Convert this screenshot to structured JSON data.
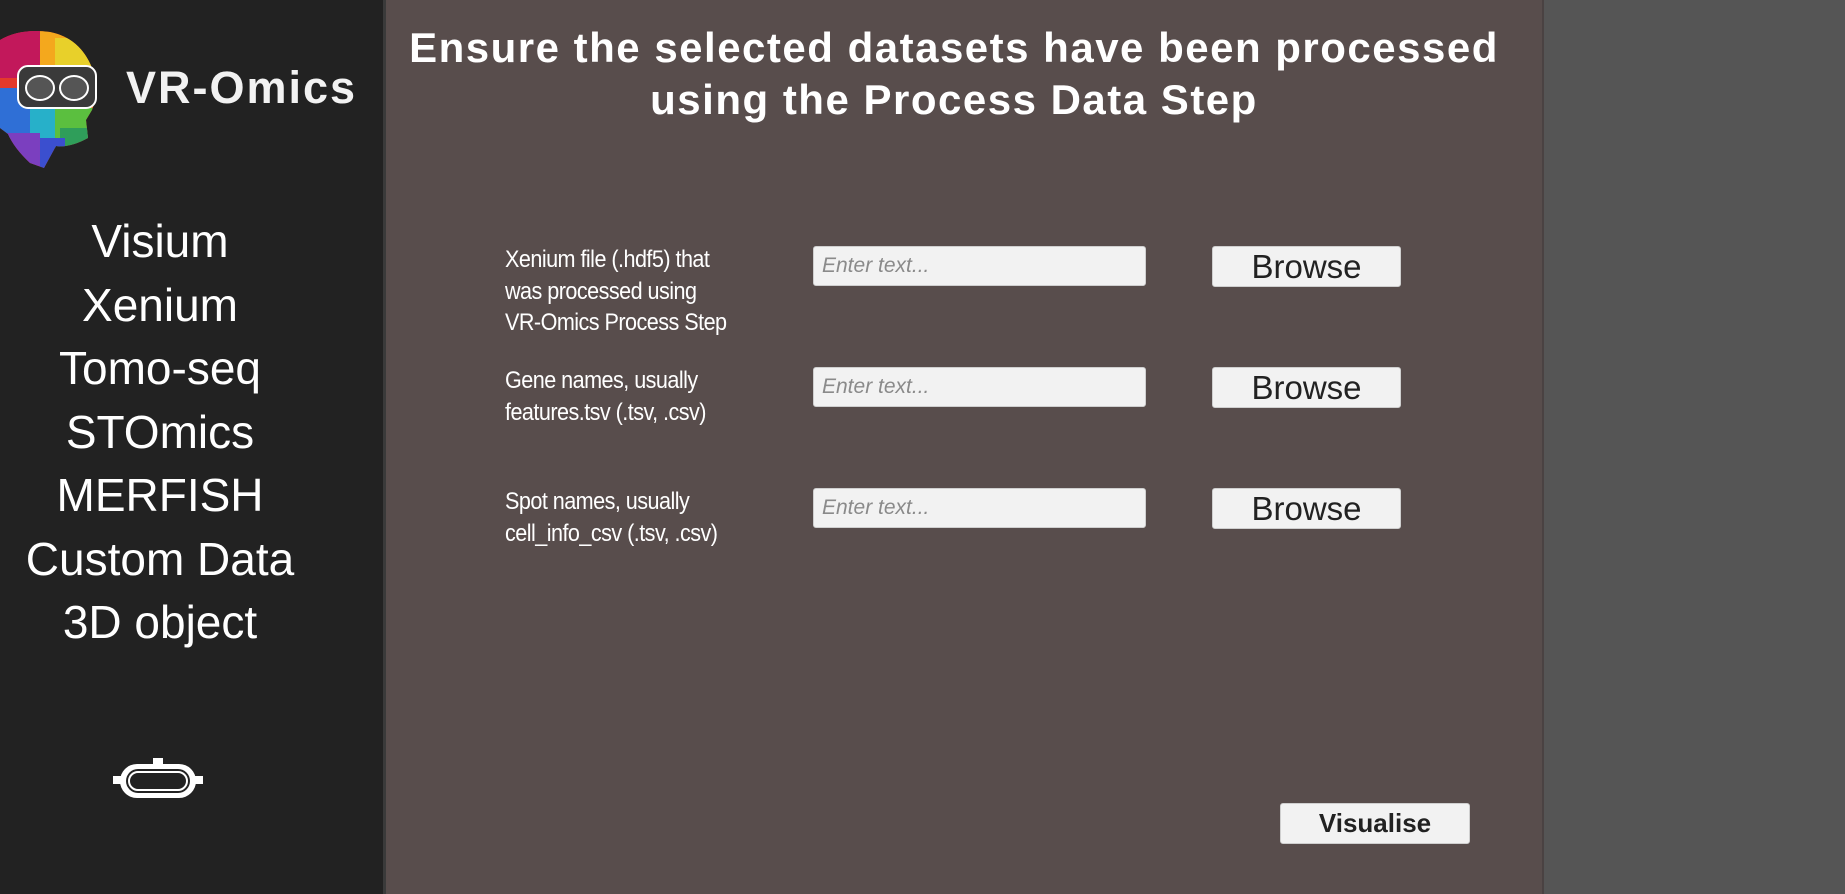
{
  "app": {
    "title": "VR-Omics"
  },
  "sidebar": {
    "items": [
      {
        "label": "Visium"
      },
      {
        "label": "Xenium"
      },
      {
        "label": "Tomo-seq"
      },
      {
        "label": "STOmics"
      },
      {
        "label": "MERFISH"
      },
      {
        "label": "Custom Data"
      },
      {
        "label": "3D object"
      }
    ],
    "bottom_icon": "vr-headset-icon"
  },
  "main": {
    "heading_line1": "Ensure the selected datasets have been processed",
    "heading_line2": "using the Process Data Step",
    "rows": [
      {
        "label_lines": [
          "Xenium file (.hdf5) that",
          "was processed using",
          "VR-Omics Process Step"
        ],
        "placeholder": "Enter text...",
        "value": "",
        "button": "Browse"
      },
      {
        "label_lines": [
          "Gene names, usually",
          "features.tsv (.tsv, .csv)"
        ],
        "placeholder": "Enter text...",
        "value": "",
        "button": "Browse"
      },
      {
        "label_lines": [
          "Spot names, usually",
          "cell_info_csv (.tsv, .csv)"
        ],
        "placeholder": "Enter text...",
        "value": "",
        "button": "Browse"
      }
    ],
    "visualise_label": "Visualise"
  },
  "colors": {
    "sidebar_bg": "#222222",
    "main_bg": "#584d4c",
    "outer_bg": "#555555",
    "button_bg": "#f2f2f2"
  }
}
